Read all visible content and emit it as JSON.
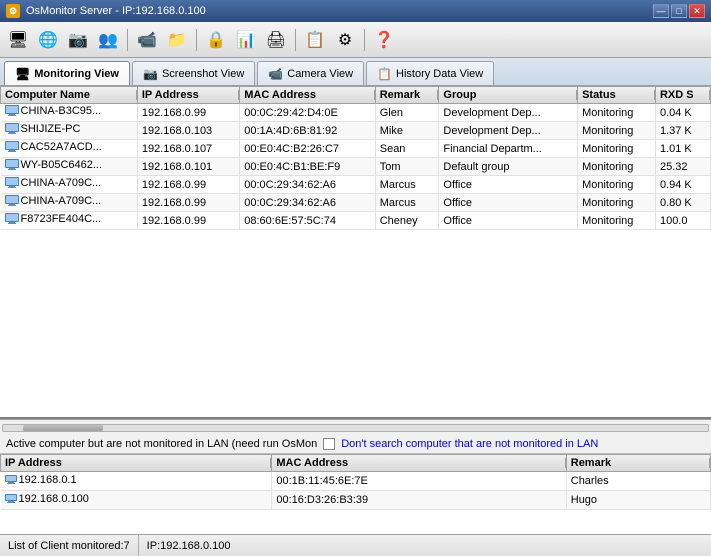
{
  "titlebar": {
    "title": "OsMonitor Server - IP:192.168.0.100",
    "icon_label": "OS",
    "min_btn": "—",
    "max_btn": "□",
    "close_btn": "✕"
  },
  "toolbar": {
    "buttons": [
      {
        "name": "monitor-icon",
        "icon": "🖥"
      },
      {
        "name": "globe-icon",
        "icon": "🌐"
      },
      {
        "name": "screenshot-icon",
        "icon": "📷"
      },
      {
        "name": "users-icon",
        "icon": "👥"
      },
      {
        "name": "camera-icon",
        "icon": "📹"
      },
      {
        "name": "folder-icon",
        "icon": "📁"
      },
      {
        "name": "lock-icon",
        "icon": "🔒"
      },
      {
        "name": "chart-icon",
        "icon": "📊"
      },
      {
        "name": "print-icon",
        "icon": "🖨"
      },
      {
        "name": "history-icon",
        "icon": "📋"
      },
      {
        "name": "settings-icon",
        "icon": "⚙"
      },
      {
        "name": "help-icon",
        "icon": "❓"
      }
    ]
  },
  "tabs": [
    {
      "label": "Monitoring View",
      "icon": "🖥",
      "active": true
    },
    {
      "label": "Screenshot View",
      "icon": "📷",
      "active": false
    },
    {
      "label": "Camera View",
      "icon": "📹",
      "active": false
    },
    {
      "label": "History Data View",
      "icon": "📋",
      "active": false
    }
  ],
  "table": {
    "headers": [
      "Computer Name",
      "IP Address",
      "MAC Address",
      "Remark",
      "Group",
      "Status",
      "RXD S"
    ],
    "rows": [
      {
        "computer": "CHINA-B3C95...",
        "ip": "192.168.0.99",
        "mac": "00:0C:29:42:D4:0E",
        "remark": "Glen",
        "group": "Development Dep...",
        "status": "Monitoring",
        "rxd": "0.04 K"
      },
      {
        "computer": "SHIJIZE-PC",
        "ip": "192.168.0.103",
        "mac": "00:1A:4D:6B:81:92",
        "remark": "Mike",
        "group": "Development Dep...",
        "status": "Monitoring",
        "rxd": "1.37 K"
      },
      {
        "computer": "CAC52A7ACD...",
        "ip": "192.168.0.107",
        "mac": "00:E0:4C:B2:26:C7",
        "remark": "Sean",
        "group": "Financial Departm...",
        "status": "Monitoring",
        "rxd": "1.01 K"
      },
      {
        "computer": "WY-B05C6462...",
        "ip": "192.168.0.101",
        "mac": "00:E0:4C:B1:BE:F9",
        "remark": "Tom",
        "group": "Default group",
        "status": "Monitoring",
        "rxd": "25.32"
      },
      {
        "computer": "CHINA-A709C...",
        "ip": "192.168.0.99",
        "mac": "00:0C:29:34:62:A6",
        "remark": "Marcus",
        "group": "Office",
        "status": "Monitoring",
        "rxd": "0.94 K"
      },
      {
        "computer": "CHINA-A709C...",
        "ip": "192.168.0.99",
        "mac": "00:0C:29:34:62:A6",
        "remark": "Marcus",
        "group": "Office",
        "status": "Monitoring",
        "rxd": "0.80 K"
      },
      {
        "computer": "F8723FE404C...",
        "ip": "192.168.0.99",
        "mac": "08:60:6E:57:5C:74",
        "remark": "Cheney",
        "group": "Office",
        "status": "Monitoring",
        "rxd": "100.0"
      }
    ]
  },
  "bottom_notice": {
    "text1": "Active computer but are not monitored in LAN (need run OsMon",
    "checkbox_label": "",
    "link_text": "Don't search computer that are not monitored in LAN"
  },
  "bottom_table": {
    "headers": [
      "IP Address",
      "MAC Address",
      "Remark"
    ],
    "rows": [
      {
        "ip": "192.168.0.1",
        "mac": "00:1B:11:45:6E:7E",
        "remark": "Charles"
      },
      {
        "ip": "192.168.0.100",
        "mac": "00:16:D3:26:B3:39",
        "remark": "Hugo"
      }
    ]
  },
  "statusbar": {
    "left": "List of Client monitored:7",
    "right": "IP:192.168.0.100"
  }
}
